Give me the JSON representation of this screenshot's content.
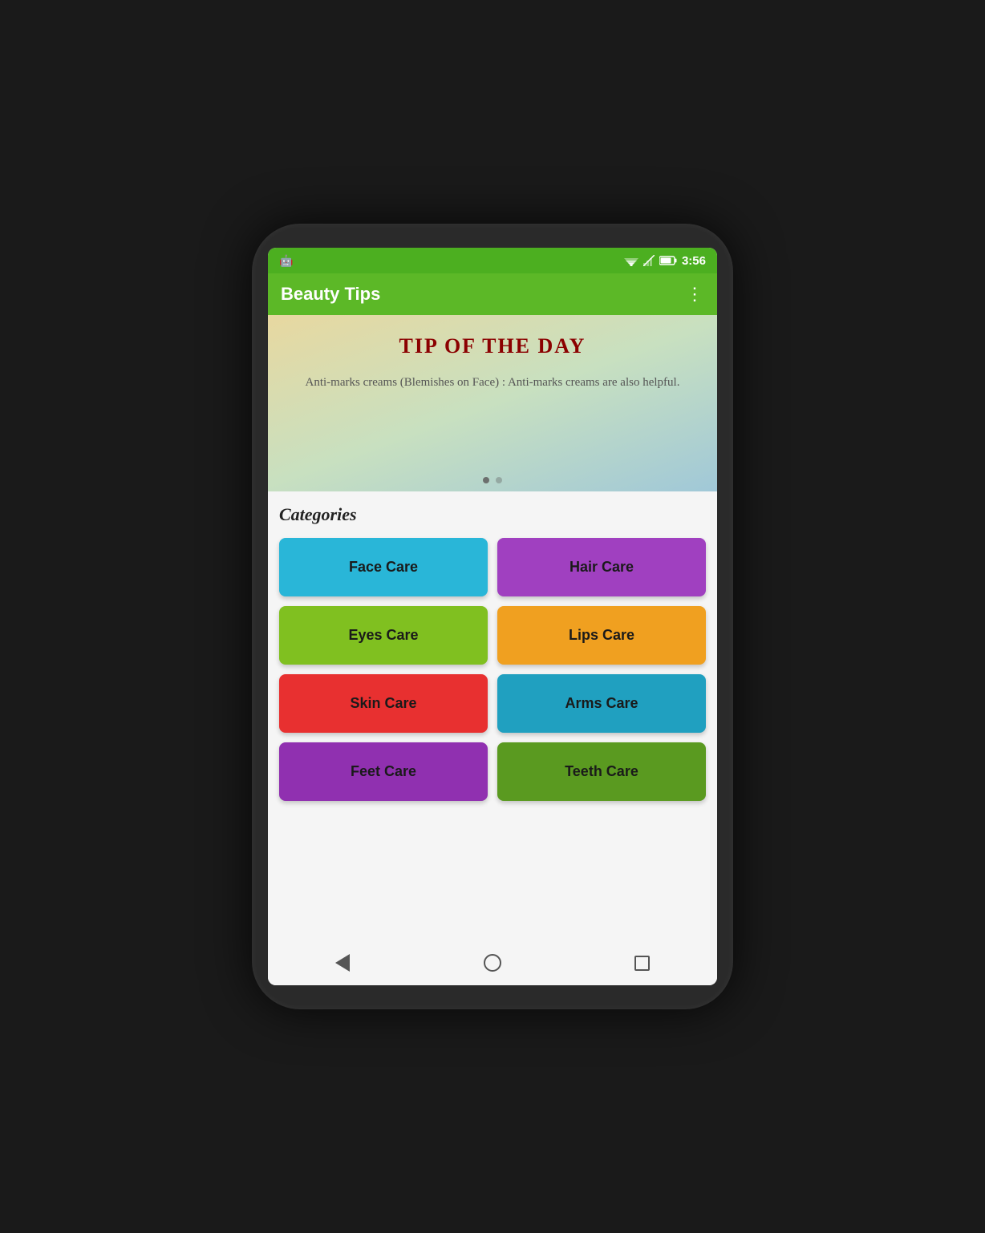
{
  "status_bar": {
    "time": "3:56"
  },
  "app_bar": {
    "title": "Beauty Tips",
    "more_icon": "⋮"
  },
  "banner": {
    "tip_title": "TIP OF THE DAY",
    "tip_text": "Anti-marks creams (Blemishes on Face) : Anti-marks creams are also helpful.",
    "dots": [
      {
        "active": true
      },
      {
        "active": false
      }
    ]
  },
  "categories": {
    "title": "Categories",
    "items": [
      {
        "label": "Face Care",
        "class": "btn-face-care",
        "name": "face-care-button"
      },
      {
        "label": "Hair Care",
        "class": "btn-hair-care",
        "name": "hair-care-button"
      },
      {
        "label": "Eyes Care",
        "class": "btn-eyes-care",
        "name": "eyes-care-button"
      },
      {
        "label": "Lips Care",
        "class": "btn-lips-care",
        "name": "lips-care-button"
      },
      {
        "label": "Skin Care",
        "class": "btn-skin-care",
        "name": "skin-care-button"
      },
      {
        "label": "Arms Care",
        "class": "btn-arms-care",
        "name": "arms-care-button"
      },
      {
        "label": "Feet Care",
        "class": "btn-feet-care",
        "name": "feet-care-button"
      },
      {
        "label": "Teeth Care",
        "class": "btn-teeth-care",
        "name": "teeth-care-button"
      }
    ]
  },
  "nav": {
    "back_label": "Back",
    "home_label": "Home",
    "recents_label": "Recents"
  }
}
